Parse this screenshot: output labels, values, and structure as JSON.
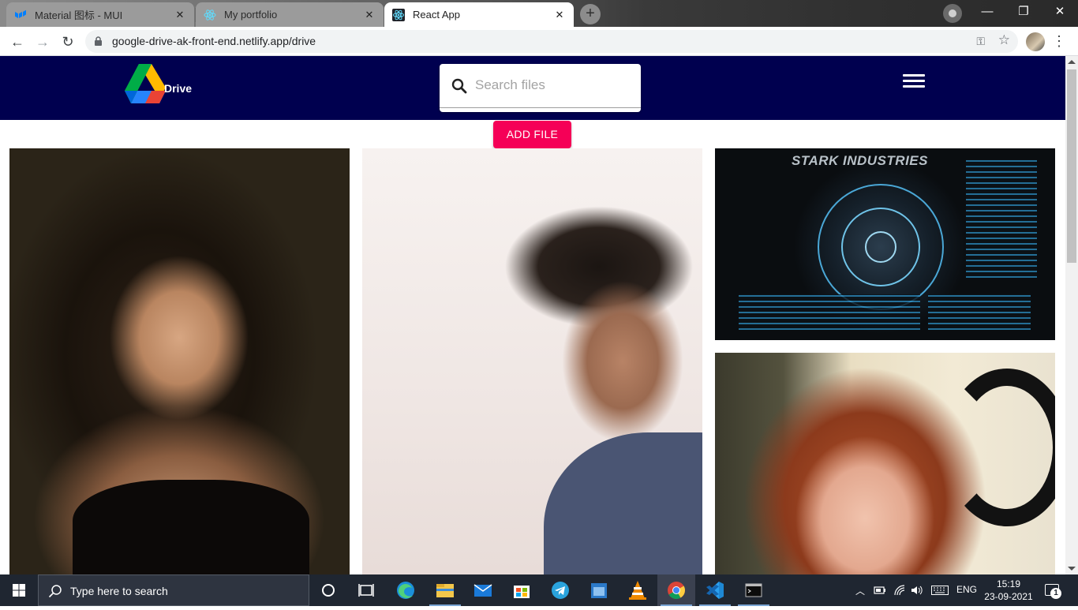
{
  "browser": {
    "tabs": [
      {
        "title": "Material 图标 - MUI",
        "active": false
      },
      {
        "title": "My portfolio",
        "active": false
      },
      {
        "title": "React App",
        "active": true
      }
    ],
    "new_tab_label": "+",
    "url": "google-drive-ak-front-end.netlify.app/drive"
  },
  "app": {
    "logo_text": "Drive",
    "search_placeholder": "Search files",
    "add_file_label": "ADD FILE",
    "bar_color": "#00004f",
    "accent_color": "#f50057"
  },
  "gallery": {
    "images": [
      {
        "name": "portrait-woman-dark"
      },
      {
        "name": "portrait-man"
      },
      {
        "name": "stark-industries-hud",
        "caption": "STARK INDUSTRIES"
      },
      {
        "name": "portrait-woman-red-hair"
      }
    ]
  },
  "taskbar": {
    "search_text": "Type here to search",
    "language": "ENG",
    "time": "15:19",
    "date": "23-09-2021",
    "notification_count": "1",
    "apps": [
      "task-view",
      "edge",
      "file-explorer",
      "mail",
      "store",
      "telegram",
      "app-window",
      "vlc",
      "chrome",
      "vscode",
      "terminal"
    ]
  }
}
